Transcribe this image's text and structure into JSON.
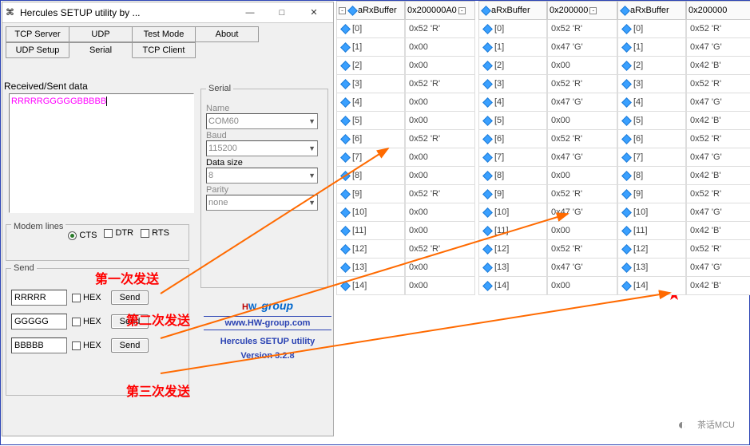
{
  "window": {
    "title": "Hercules SETUP utility by ...",
    "min": "—",
    "max": "□",
    "close": "✕"
  },
  "tabs_row1": [
    "TCP Server",
    "UDP",
    "Test Mode",
    "About"
  ],
  "tabs_row2": [
    "UDP Setup",
    "Serial",
    "TCP Client"
  ],
  "active_tab": "Serial",
  "rs_label": "Received/Sent data",
  "rs_text": "RRRRRGGGGGBBBBB",
  "serial_fs": {
    "legend": "Serial",
    "name_lbl": "Name",
    "name_val": "COM60",
    "baud_lbl": "Baud",
    "baud_val": "115200",
    "ds_lbl": "Data size",
    "ds_val": "8",
    "parity_lbl": "Parity",
    "parity_val": "none"
  },
  "modem_fs": {
    "legend": "Modem lines",
    "cts": "CTS",
    "dtr": "DTR",
    "rts": "RTS"
  },
  "send_fs": {
    "legend": "Send",
    "rows": [
      {
        "val": "RRRRR",
        "hex": "HEX",
        "btn": "Send"
      },
      {
        "val": "GGGGG",
        "hex": "HEX",
        "btn": "Send"
      },
      {
        "val": "BBBBB",
        "hex": "HEX",
        "btn": "Send"
      }
    ]
  },
  "anno": {
    "s1": "第一次发送",
    "s2": "第二次发送",
    "s3": "第三次发送"
  },
  "hw": {
    "url": "www.HW-group.com",
    "setup": "Hercules SETUP utility",
    "ver": "Version  3.2.8",
    "h": "H",
    "w": "W",
    "g": "group"
  },
  "mem_headers": {
    "name": "aRxBuffer",
    "addr1": "0x200000A0",
    "addr2": "0x200000",
    "addr3": "0x200000"
  },
  "mem_indices": [
    "[0]",
    "[1]",
    "[2]",
    "[3]",
    "[4]",
    "[5]",
    "[6]",
    "[7]",
    "[8]",
    "[9]",
    "[10]",
    "[11]",
    "[12]",
    "[13]",
    "[14]"
  ],
  "mem_col1": [
    "0x52 'R'",
    "0x00",
    "0x00",
    "0x52 'R'",
    "0x00",
    "0x00",
    "0x52 'R'",
    "0x00",
    "0x00",
    "0x52 'R'",
    "0x00",
    "0x00",
    "0x52 'R'",
    "0x00",
    "0x00"
  ],
  "mem_col2": [
    "0x52 'R'",
    "0x47 'G'",
    "0x00",
    "0x52 'R'",
    "0x47 'G'",
    "0x00",
    "0x52 'R'",
    "0x47 'G'",
    "0x00",
    "0x52 'R'",
    "0x47 'G'",
    "0x00",
    "0x52 'R'",
    "0x47 'G'",
    "0x00"
  ],
  "mem_col3": [
    "0x52 'R'",
    "0x47 'G'",
    "0x42 'B'",
    "0x52 'R'",
    "0x47 'G'",
    "0x42 'B'",
    "0x52 'R'",
    "0x47 'G'",
    "0x42 'B'",
    "0x52 'R'",
    "0x47 'G'",
    "0x42 'B'",
    "0x52 'R'",
    "0x47 'G'",
    "0x42 'B'"
  ],
  "watermark": "茶话MCU"
}
